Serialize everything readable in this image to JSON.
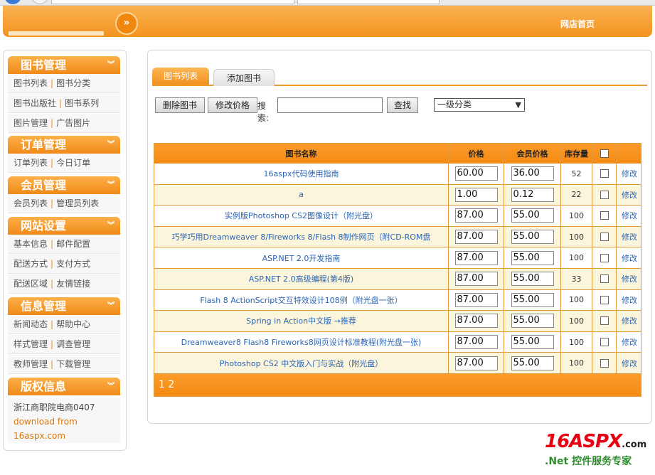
{
  "header": {
    "nav_glyph": "»",
    "home_link": "网店首页"
  },
  "sidebar": {
    "sections": [
      {
        "title": "图书管理",
        "rows": [
          [
            "图书列表",
            "图书分类"
          ],
          [
            "图书出版社",
            "图书系列"
          ],
          [
            "图片管理",
            "广告图片"
          ]
        ]
      },
      {
        "title": "订单管理",
        "rows": [
          [
            "订单列表",
            "今日订单"
          ]
        ]
      },
      {
        "title": "会员管理",
        "rows": [
          [
            "会员列表",
            "管理员列表"
          ]
        ]
      },
      {
        "title": "网站设置",
        "rows": [
          [
            "基本信息",
            "邮件配置"
          ],
          [
            "配送方式",
            "支付方式"
          ],
          [
            "配送区域",
            "友情链接"
          ]
        ]
      },
      {
        "title": "信息管理",
        "rows": [
          [
            "新闻动态",
            "帮助中心"
          ],
          [
            "样式管理",
            "调查管理"
          ],
          [
            "教师管理",
            "下载管理"
          ]
        ]
      }
    ],
    "copyright": {
      "title": "版权信息",
      "line1": "浙江商职院电商0407",
      "line2": "download from",
      "line3": "16aspx.com"
    },
    "chevron": "︾"
  },
  "main": {
    "tabs": {
      "active": "图书列表",
      "inactive": "添加图书"
    },
    "toolbar": {
      "delete_btn": "删除图书",
      "edit_price_btn": "修改价格",
      "search_label": "搜索:",
      "search_value": "",
      "find_btn": "查找",
      "category_selected": "一级分类"
    },
    "table": {
      "headers": {
        "name": "图书名称",
        "price": "价格",
        "member_price": "会员价格",
        "stock": "库存量"
      },
      "rows": [
        {
          "name": "16aspx代码使用指南",
          "price": "60.00",
          "member_price": "36.00",
          "stock": "52",
          "action": "修改"
        },
        {
          "name": "a",
          "price": "1.00",
          "member_price": "0.12",
          "stock": "22",
          "action": "修改"
        },
        {
          "name": "实例版Photoshop CS2图像设计（附光盘）",
          "price": "87.00",
          "member_price": "55.00",
          "stock": "100",
          "action": "修改"
        },
        {
          "name": "巧学巧用Dreamweaver 8/Fireworks 8/Flash 8制作网页（附CD-ROM盘",
          "price": "87.00",
          "member_price": "55.00",
          "stock": "100",
          "action": "修改"
        },
        {
          "name": "ASP.NET 2.0开发指南",
          "price": "87.00",
          "member_price": "55.00",
          "stock": "100",
          "action": "修改"
        },
        {
          "name": "ASP.NET 2.0高级编程(第4版)",
          "price": "87.00",
          "member_price": "55.00",
          "stock": "33",
          "action": "修改"
        },
        {
          "name": "Flash 8 ActionScript交互特效设计108例（附光盘一张）",
          "price": "87.00",
          "member_price": "55.00",
          "stock": "100",
          "action": "修改"
        },
        {
          "name": "Spring in Action中文版 →推荐",
          "price": "87.00",
          "member_price": "55.00",
          "stock": "100",
          "action": "修改"
        },
        {
          "name": "Dreamweaver8 Flash8 Fireworks8网页设计标准教程(附光盘一张)",
          "price": "87.00",
          "member_price": "55.00",
          "stock": "100",
          "action": "修改"
        },
        {
          "name": "Photoshop CS2 中文版入门与实战（附光盘）",
          "price": "87.00",
          "member_price": "55.00",
          "stock": "100",
          "action": "修改"
        }
      ],
      "pager": "1 2"
    }
  },
  "brand": {
    "logo_main": "16ASPX",
    "logo_suffix": ".com",
    "tagline": ".Net 控件服务专家"
  },
  "colors": {
    "accent": "#f39222",
    "link": "#2a64b5",
    "alt_row": "#fbf5dc"
  }
}
